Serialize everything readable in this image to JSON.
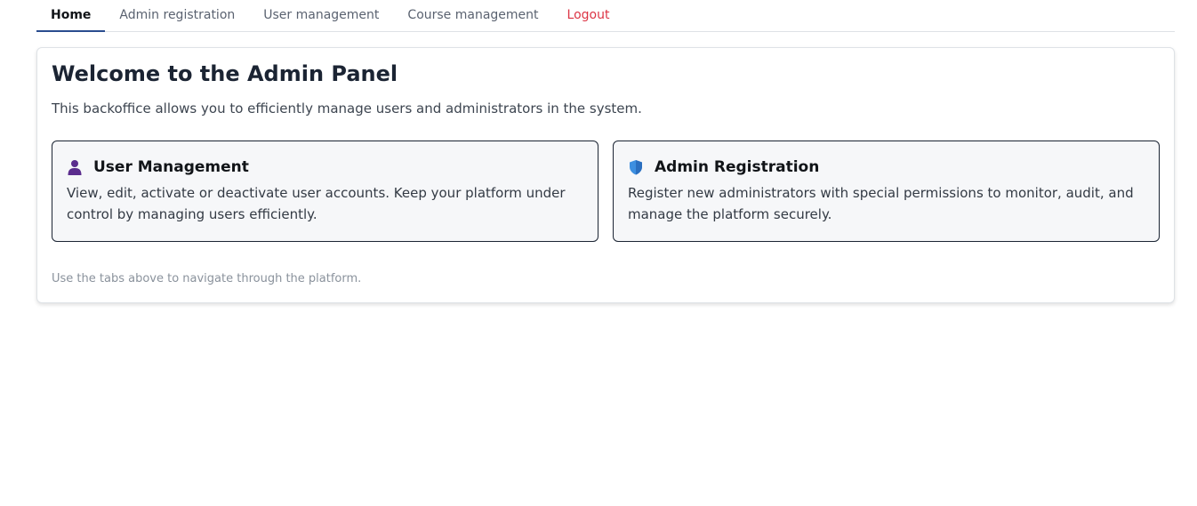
{
  "nav": {
    "tabs": [
      {
        "label": "Home"
      },
      {
        "label": "Admin registration"
      },
      {
        "label": "User management"
      },
      {
        "label": "Course management"
      },
      {
        "label": "Logout"
      }
    ]
  },
  "panel": {
    "title": "Welcome to the Admin Panel",
    "subtitle": "This backoffice allows you to efficiently manage users and administrators in the system.",
    "cards": [
      {
        "icon": "user-icon",
        "title": "User Management",
        "text": "View, edit, activate or deactivate user accounts. Keep your platform under control by managing users efficiently."
      },
      {
        "icon": "shield-icon",
        "title": "Admin Registration",
        "text": "Register new administrators with special permissions to monitor, audit, and manage the platform securely."
      }
    ],
    "hint": "Use the tabs above to navigate through the platform."
  },
  "colors": {
    "active_tab_underline": "#2a4d8f",
    "logout": "#dc3545",
    "user_icon": "#5b2d8e",
    "shield_icon": "#3d8fe0"
  }
}
